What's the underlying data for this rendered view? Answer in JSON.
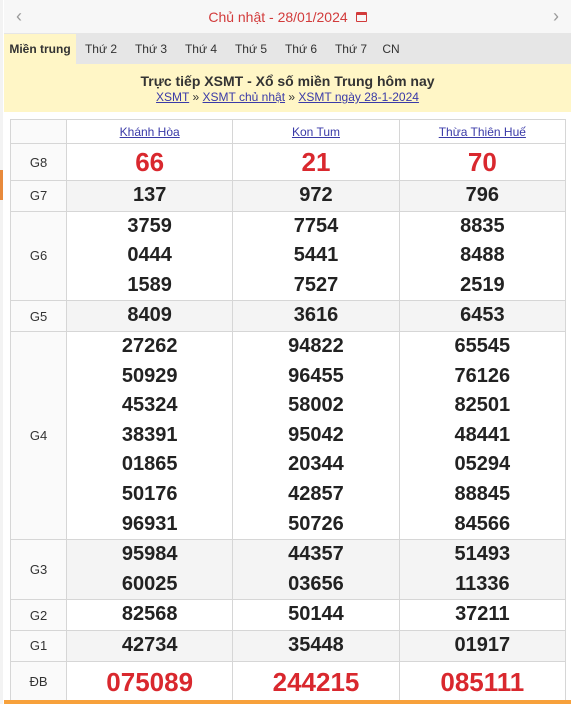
{
  "date_nav": {
    "prev": "‹",
    "next": "›",
    "label": "Chủ nhật -  28/01/2024"
  },
  "tabs": [
    "Miền trung",
    "Thứ 2",
    "Thứ 3",
    "Thứ 4",
    "Thứ 5",
    "Thứ 6",
    "Thứ 7",
    "CN"
  ],
  "header": {
    "title": "Trực tiếp XSMT - Xổ số miền Trung hôm nay",
    "crumbs": [
      "XSMT",
      "XSMT chủ nhật",
      "XSMT ngày 28-1-2024"
    ],
    "sep": "»"
  },
  "provinces": [
    "Khánh Hòa",
    "Kon Tum",
    "Thừa Thiên Huế"
  ],
  "prizes": {
    "G8": {
      "label": "G8",
      "values": [
        [
          "66"
        ],
        [
          "21"
        ],
        [
          "70"
        ]
      ]
    },
    "G7": {
      "label": "G7",
      "values": [
        [
          "137"
        ],
        [
          "972"
        ],
        [
          "796"
        ]
      ]
    },
    "G6": {
      "label": "G6",
      "values": [
        [
          "3759",
          "0444",
          "1589"
        ],
        [
          "7754",
          "5441",
          "7527"
        ],
        [
          "8835",
          "8488",
          "2519"
        ]
      ]
    },
    "G5": {
      "label": "G5",
      "values": [
        [
          "8409"
        ],
        [
          "3616"
        ],
        [
          "6453"
        ]
      ]
    },
    "G4": {
      "label": "G4",
      "values": [
        [
          "27262",
          "50929",
          "45324",
          "38391",
          "01865",
          "50176",
          "96931"
        ],
        [
          "94822",
          "96455",
          "58002",
          "95042",
          "20344",
          "42857",
          "50726"
        ],
        [
          "65545",
          "76126",
          "82501",
          "48441",
          "05294",
          "88845",
          "84566"
        ]
      ]
    },
    "G3": {
      "label": "G3",
      "values": [
        [
          "95984",
          "60025"
        ],
        [
          "44357",
          "03656"
        ],
        [
          "51493",
          "11336"
        ]
      ]
    },
    "G2": {
      "label": "G2",
      "values": [
        [
          "82568"
        ],
        [
          "50144"
        ],
        [
          "37211"
        ]
      ]
    },
    "G1": {
      "label": "G1",
      "values": [
        [
          "42734"
        ],
        [
          "35448"
        ],
        [
          "01917"
        ]
      ]
    },
    "DB": {
      "label": "ĐB",
      "values": [
        [
          "075089"
        ],
        [
          "244215"
        ],
        [
          "085111"
        ]
      ]
    }
  }
}
